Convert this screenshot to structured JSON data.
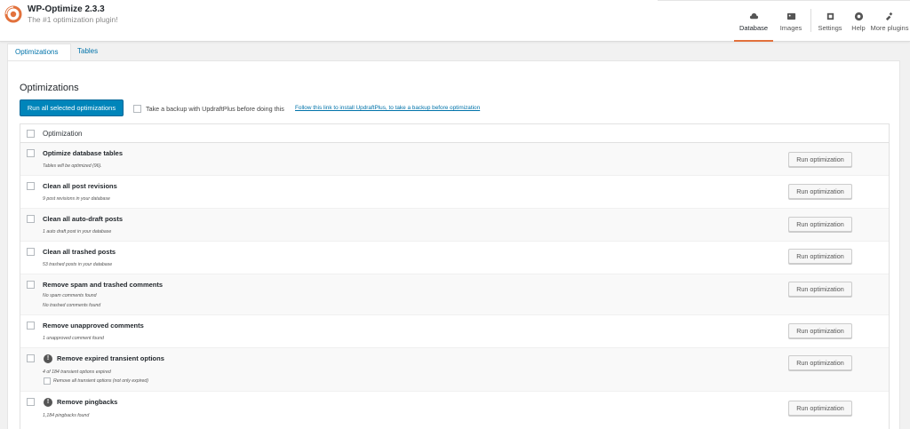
{
  "brand": {
    "title": "WP-Optimize 2.3.3",
    "subtitle": "The #1 optimization plugin!",
    "accent_color": "#e2713c"
  },
  "nav": [
    {
      "label": "Database",
      "icon": "database-icon",
      "active": true
    },
    {
      "label": "Images",
      "icon": "images-icon",
      "active": false
    },
    {
      "label": "Settings",
      "icon": "settings-icon",
      "active": false
    },
    {
      "label": "Help",
      "icon": "help-icon",
      "active": false
    },
    {
      "label": "More plugins",
      "icon": "plugin-icon",
      "active": false
    }
  ],
  "tabs": [
    {
      "label": "Optimizations",
      "active": true
    },
    {
      "label": "Tables",
      "active": false
    }
  ],
  "main": {
    "title": "Optimizations",
    "run_all_label": "Run all selected optimizations",
    "backup_text": "Take a backup with UpdraftPlus before doing this",
    "backup_link": "Follow this link to install UpdraftPlus, to take a backup before optimization",
    "column_header": "Optimization",
    "run_label": "Run optimization",
    "rows": [
      {
        "title": "Optimize database tables",
        "details": [
          "Tables will be optimized (96)."
        ]
      },
      {
        "title": "Clean all post revisions",
        "details": [
          "9 post revisions in your database"
        ]
      },
      {
        "title": "Clean all auto-draft posts",
        "details": [
          "1 auto draft post in your database"
        ]
      },
      {
        "title": "Clean all trashed posts",
        "details": [
          "53 trashed posts in your database"
        ]
      },
      {
        "title": "Remove spam and trashed comments",
        "details": [
          "No spam comments found",
          "No trashed comments found"
        ]
      },
      {
        "title": "Remove unapproved comments",
        "details": [
          "1 unapproved comment found"
        ]
      },
      {
        "title": "Remove expired transient options",
        "details": [
          "4 of 184 transient options expired"
        ],
        "sub_option": "Remove all transient options (not only expired)",
        "icon": "info-icon"
      },
      {
        "title": "Remove pingbacks",
        "details": [
          "1,184 pingbacks found"
        ],
        "icon": "info-icon"
      }
    ]
  }
}
